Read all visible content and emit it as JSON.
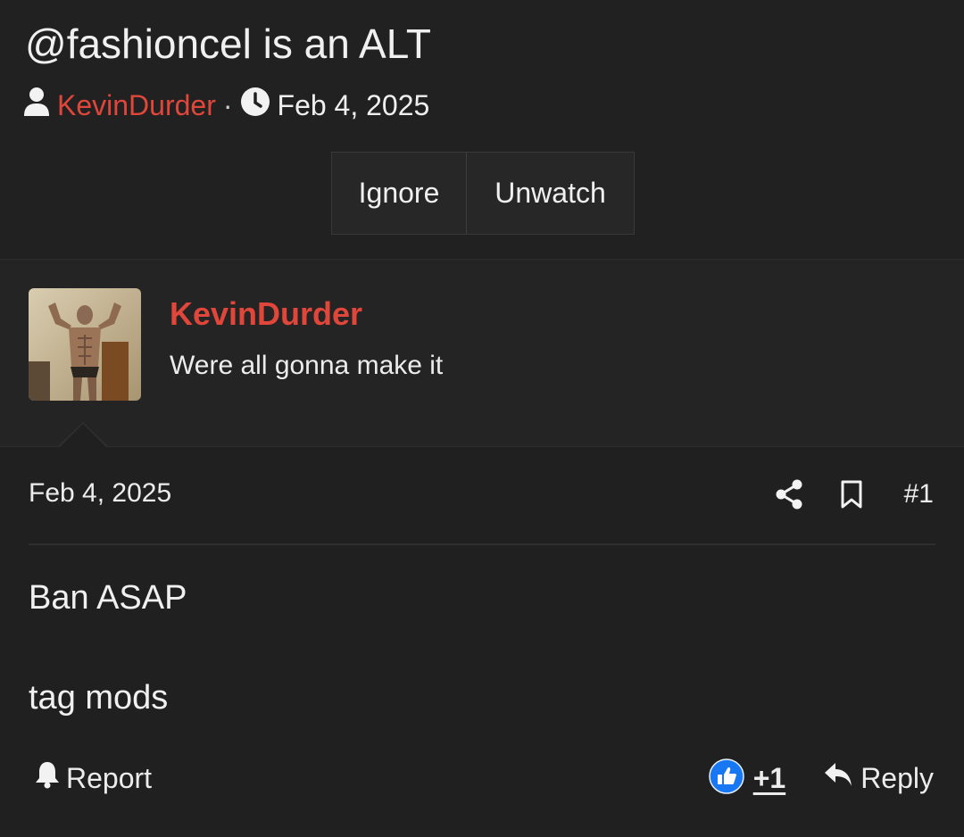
{
  "thread": {
    "title": "@fashioncel is an ALT",
    "author": "KevinDurder",
    "separator": "·",
    "date": "Feb 4, 2025",
    "buttons": {
      "ignore": "Ignore",
      "unwatch": "Unwatch"
    }
  },
  "post": {
    "author_name": "KevinDurder",
    "author_title": "Were all gonna make it",
    "date": "Feb 4, 2025",
    "number": "#1",
    "body": [
      "Ban ASAP",
      "tag mods"
    ],
    "footer": {
      "report_label": "Report",
      "like_count": "+1",
      "reply_label": "Reply"
    }
  },
  "icons": {
    "user": "user-icon",
    "clock": "clock-icon",
    "share": "share-icon",
    "bookmark": "bookmark-icon",
    "bell": "bell-icon",
    "like": "like-icon",
    "reply": "reply-icon"
  },
  "colors": {
    "accent": "#e0463a",
    "background": "#202020",
    "like_badge": "#1877f2"
  }
}
